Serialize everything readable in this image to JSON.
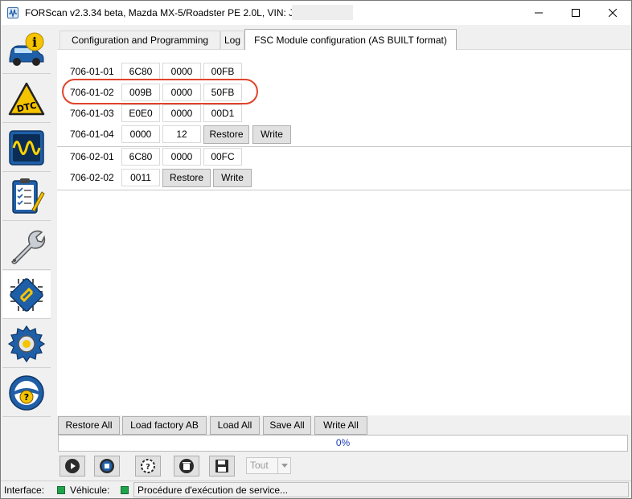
{
  "window": {
    "title": "FORScan v2.3.34 beta, Mazda MX-5/Roadster PE 2.0L, VIN: JMZ",
    "controls": [
      "minimize-icon",
      "maximize-icon",
      "close-icon"
    ]
  },
  "sidebar": {
    "items": [
      {
        "name": "vehicle-info",
        "icon": "car-info-icon"
      },
      {
        "name": "dtc",
        "icon": "dtc-warning-icon",
        "text": "DTC"
      },
      {
        "name": "oscilloscope",
        "icon": "oscilloscope-icon"
      },
      {
        "name": "tests",
        "icon": "checklist-icon"
      },
      {
        "name": "service",
        "icon": "wrench-icon"
      },
      {
        "name": "configuration",
        "icon": "module-chip-icon",
        "active": true
      },
      {
        "name": "settings",
        "icon": "gear-icon"
      },
      {
        "name": "help",
        "icon": "help-steering-icon"
      }
    ]
  },
  "tabs": [
    {
      "label": "Configuration and Programming",
      "active": false
    },
    {
      "label": "Log",
      "active": false
    },
    {
      "label": "FSC Module configuration (AS BUILT format)",
      "active": true
    }
  ],
  "rows": [
    {
      "label": "706-01-01",
      "cells": [
        "6C80",
        "0000",
        "00FB"
      ]
    },
    {
      "label": "706-01-02",
      "cells": [
        "009B",
        "0000",
        "50FB"
      ],
      "highlighted": true
    },
    {
      "label": "706-01-03",
      "cells": [
        "E0E0",
        "0000",
        "00D1"
      ]
    },
    {
      "label": "706-01-04",
      "cells": [
        "0000",
        "12"
      ],
      "buttons": [
        "Restore",
        "Write"
      ]
    },
    {
      "label": "706-02-01",
      "cells": [
        "6C80",
        "0000",
        "00FC"
      ]
    },
    {
      "label": "706-02-02",
      "cells": [
        "0011"
      ],
      "buttons": [
        "Restore",
        "Write"
      ]
    }
  ],
  "actions": {
    "restore_all": "Restore All",
    "load_factory": "Load factory AB",
    "load_all": "Load All",
    "save_all": "Save All",
    "write_all": "Write All"
  },
  "progress": {
    "text": "0%",
    "value": 0
  },
  "toolbar": {
    "tools": [
      "play-icon",
      "stop-icon",
      "help-circle-icon",
      "delete-icon",
      "save-disk-icon"
    ],
    "filter_value": "Tout"
  },
  "status": {
    "interface_label": "Interface:",
    "vehicle_label": "Véhicule:",
    "message": "Procédure d'exécution de service...",
    "led_color": "#1fa34a"
  },
  "colors": {
    "highlight": "#e0432b",
    "progress_text": "#1a3bb5"
  }
}
